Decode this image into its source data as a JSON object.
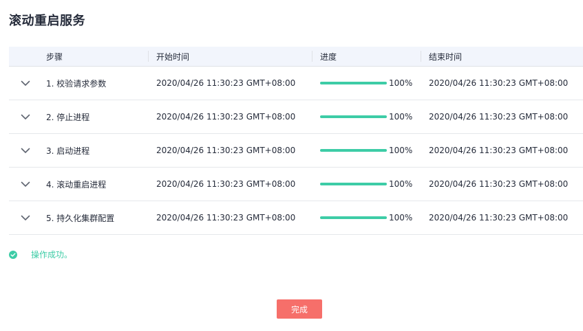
{
  "page": {
    "title": "滚动重启服务"
  },
  "table": {
    "headers": {
      "step": "步骤",
      "start": "开始时间",
      "progress": "进度",
      "end": "结束时间"
    },
    "rows": [
      {
        "step": "1. 校验请求参数",
        "start": "2020/04/26 11:30:23 GMT+08:00",
        "progress": 1.0,
        "progress_label": "100%",
        "end": "2020/04/26 11:30:23 GMT+08:00"
      },
      {
        "step": "2. 停止进程",
        "start": "2020/04/26 11:30:23 GMT+08:00",
        "progress": 1.0,
        "progress_label": "100%",
        "end": "2020/04/26 11:30:23 GMT+08:00"
      },
      {
        "step": "3. 启动进程",
        "start": "2020/04/26 11:30:23 GMT+08:00",
        "progress": 1.0,
        "progress_label": "100%",
        "end": "2020/04/26 11:30:23 GMT+08:00"
      },
      {
        "step": "4. 滚动重启进程",
        "start": "2020/04/26 11:30:23 GMT+08:00",
        "progress": 1.0,
        "progress_label": "100%",
        "end": "2020/04/26 11:30:23 GMT+08:00"
      },
      {
        "step": "5. 持久化集群配置",
        "start": "2020/04/26 11:30:23 GMT+08:00",
        "progress": 1.0,
        "progress_label": "100%",
        "end": "2020/04/26 11:30:23 GMT+08:00"
      }
    ]
  },
  "status": {
    "text": "操作成功。",
    "icon": "check-circle-icon",
    "color": "#3dcca6"
  },
  "footer": {
    "done_label": "完成",
    "done_color": "#f66f6a"
  },
  "colors": {
    "accent": "#3dcca6",
    "header_bg": "#f2f5fc"
  }
}
